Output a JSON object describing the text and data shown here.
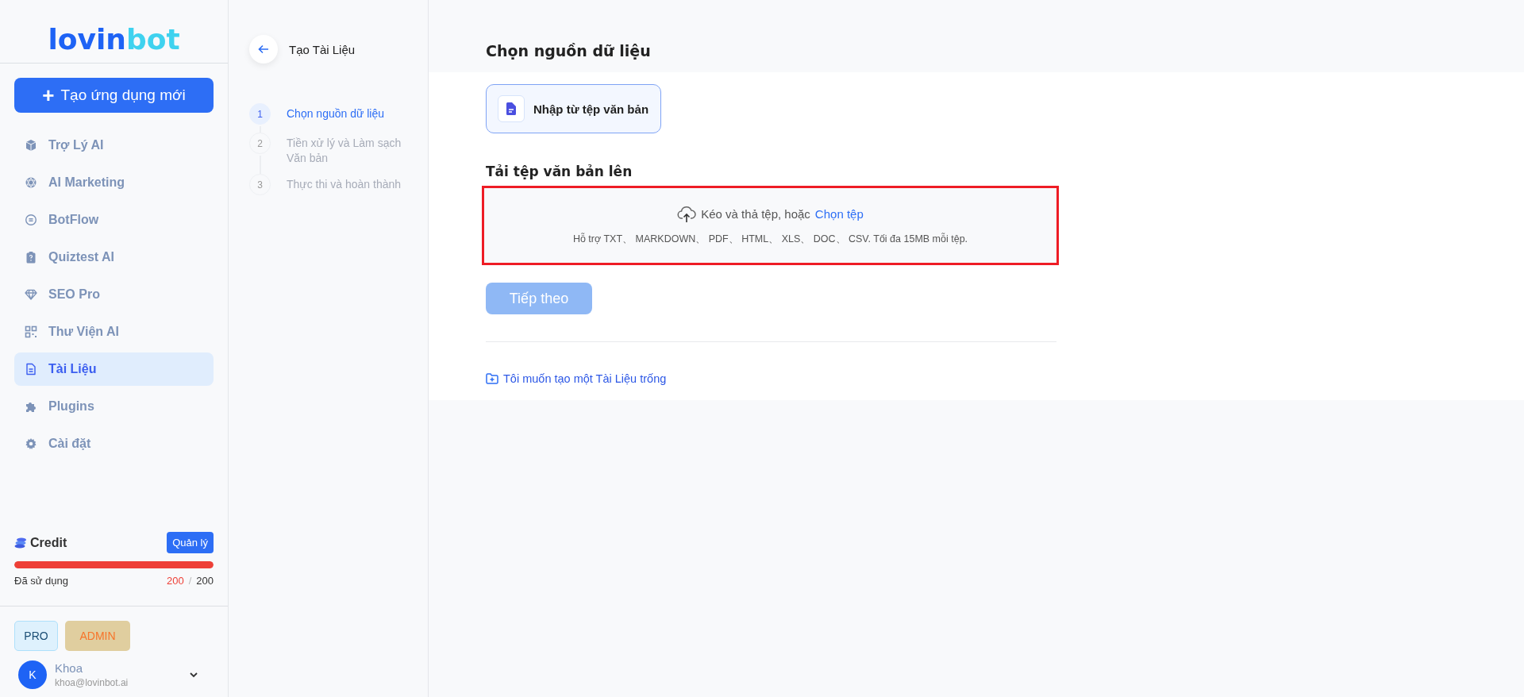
{
  "sidebar": {
    "logo": {
      "part1": "lovin",
      "part2": "bot"
    },
    "new_app_button": {
      "icon": "+",
      "label": "Tạo ứng dụng mới"
    },
    "items": [
      {
        "label": "Trợ Lý AI",
        "selected": false
      },
      {
        "label": "AI Marketing",
        "selected": false
      },
      {
        "label": "BotFlow",
        "selected": false
      },
      {
        "label": "Quiztest AI",
        "selected": false
      },
      {
        "label": "SEO Pro",
        "selected": false
      },
      {
        "label": "Thư Viện AI",
        "selected": false
      },
      {
        "label": "Tài Liệu",
        "selected": true
      },
      {
        "label": "Plugins",
        "selected": false
      },
      {
        "label": "Cài đặt",
        "selected": false
      }
    ],
    "credit": {
      "title": "Credit",
      "manage_button": "Quản lý",
      "level": 1,
      "used_label": "Đã sử dụng",
      "used": "200",
      "separator": "/",
      "total": "200"
    },
    "badges": [
      {
        "label": "PRO",
        "kind": "pro"
      },
      {
        "label": "ADMIN",
        "kind": "admin"
      }
    ],
    "user": {
      "initial": "K",
      "name": "Khoa",
      "email": "khoa@lovinbot.ai"
    }
  },
  "steps_panel": {
    "title": "Tạo Tài Liệu",
    "steps": [
      {
        "number": "1",
        "label": "Chọn nguồn dữ liệu",
        "selected": true
      },
      {
        "number": "2",
        "label": "Tiền xử lý và Làm sạch Văn bản",
        "selected": false
      },
      {
        "number": "3",
        "label": "Thực thi và hoàn thành",
        "selected": false
      }
    ]
  },
  "main": {
    "title": "Chọn nguồn dữ liệu",
    "sources": [
      {
        "label": "Nhập từ tệp văn bản",
        "selected": true
      }
    ],
    "upload": {
      "title": "Tải tệp văn bản lên",
      "prompt": "Kéo và thả tệp, hoặc",
      "pick_link": "Chọn tệp",
      "hint": "Hỗ trợ TXT、 MARKDOWN、 PDF、 HTML、 XLS、 DOC、 CSV. Tối đa 15MB mỗi tệp."
    },
    "next_button": {
      "label": "Tiếp theo",
      "disabled": true
    },
    "empty_link": "Tôi muốn tạo một Tài Liệu trống"
  }
}
